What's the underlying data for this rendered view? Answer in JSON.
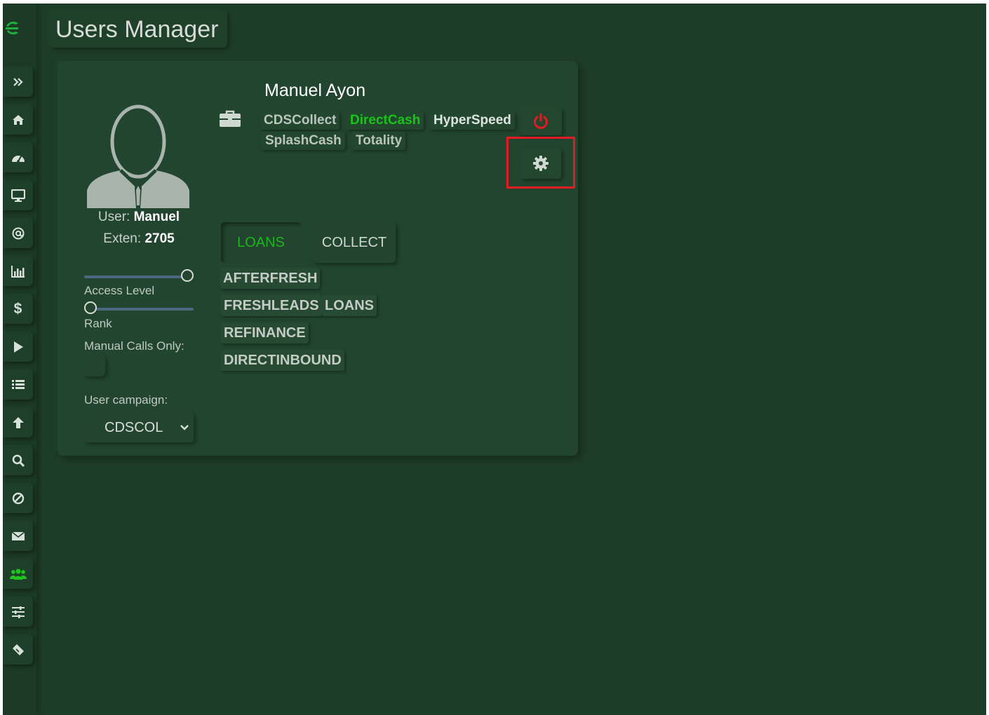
{
  "page": {
    "title": "Users Manager"
  },
  "sidebar": {
    "items": [
      {
        "icon": "chevrons-right-icon"
      },
      {
        "icon": "home-icon"
      },
      {
        "icon": "dashboard-icon"
      },
      {
        "icon": "monitor-icon"
      },
      {
        "icon": "at-icon"
      },
      {
        "icon": "bar-chart-icon"
      },
      {
        "icon": "dollar-icon",
        "glyph": "$"
      },
      {
        "icon": "play-icon"
      },
      {
        "icon": "list-icon"
      },
      {
        "icon": "arrow-up-icon"
      },
      {
        "icon": "search-icon"
      },
      {
        "icon": "ban-icon"
      },
      {
        "icon": "envelope-icon"
      },
      {
        "icon": "users-icon",
        "active": true
      },
      {
        "icon": "sliders-icon"
      },
      {
        "icon": "ticket-icon"
      }
    ]
  },
  "user": {
    "name": "Manuel Ayon",
    "user_label": "User:",
    "user_value": "Manuel",
    "exten_label": "Exten:",
    "exten_value": "2705",
    "access_level_label": "Access Level",
    "access_level_value": 1.0,
    "rank_label": "Rank",
    "rank_value": 0.0,
    "manual_calls_label": "Manual Calls Only:",
    "campaign_label": "User campaign:",
    "campaign_value": "CDSCOL"
  },
  "campaigns": {
    "items": [
      {
        "label": "CDSCollect",
        "active": false
      },
      {
        "label": "DirectCash",
        "active": true
      },
      {
        "label": "HyperSpeed",
        "active": false
      },
      {
        "label": "SplashCash",
        "active": false
      },
      {
        "label": "Totality",
        "active": false
      }
    ]
  },
  "tabs": [
    {
      "label": "LOANS",
      "active": true
    },
    {
      "label": "COLLECT",
      "active": false
    }
  ],
  "lists": [
    "AFTERFRESH",
    "FRESHLEADS",
    "LOANS",
    "REFINANCE",
    "DIRECTINBOUND"
  ],
  "colors": {
    "background": "#1e3d28",
    "card": "#224530",
    "active_green": "#19c419",
    "power_red": "#e01b24",
    "highlight_red": "#e01b24"
  }
}
